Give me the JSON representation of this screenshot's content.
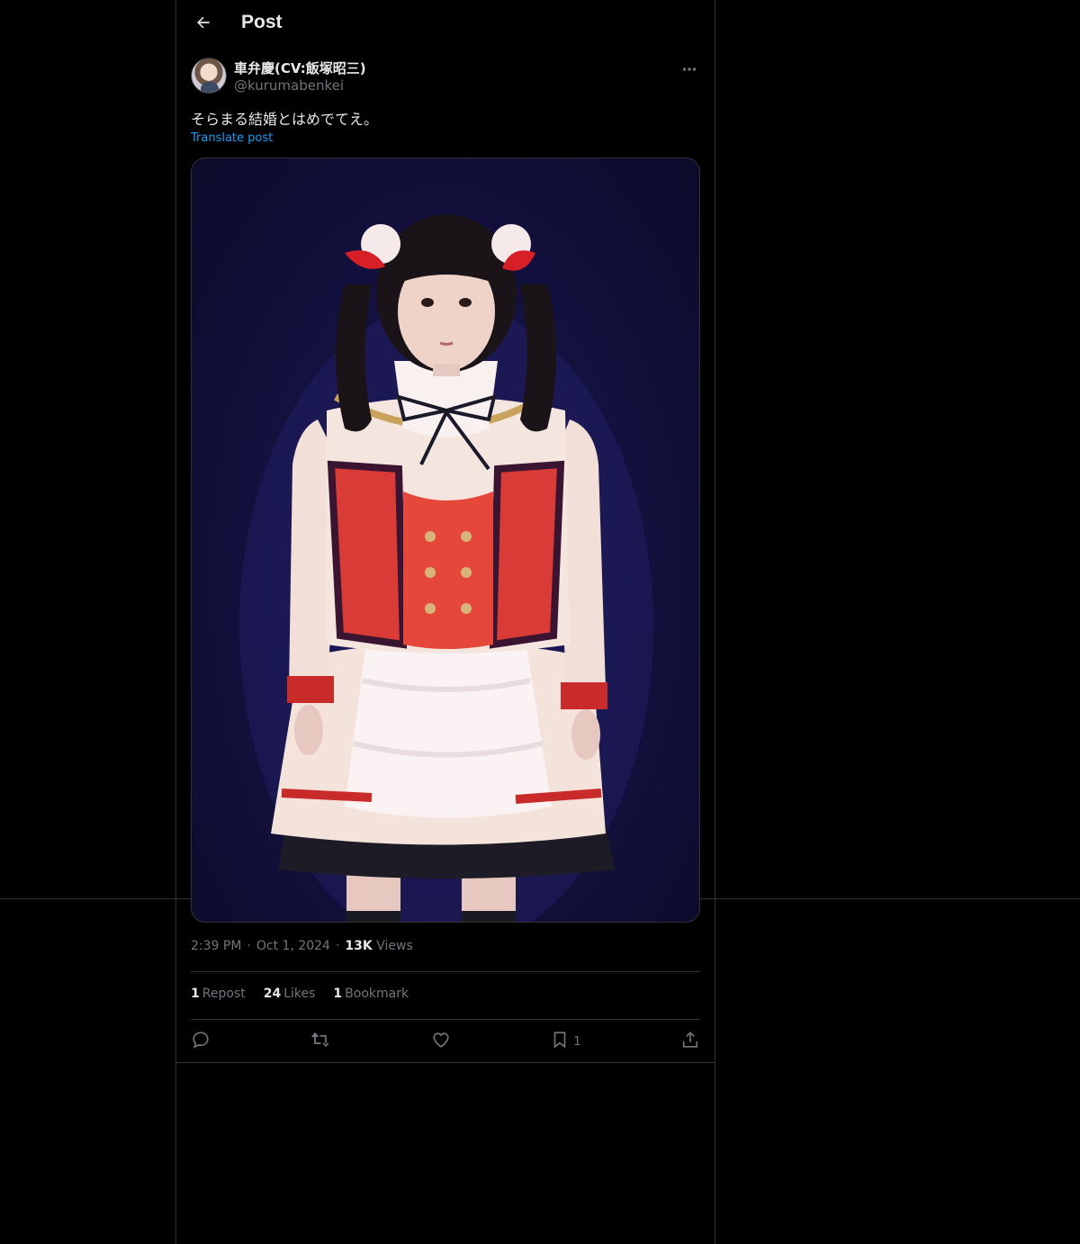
{
  "header": {
    "title": "Post"
  },
  "author": {
    "display_name": "車弁慶(CV:飯塚昭三)",
    "handle": "@kurumabenkei"
  },
  "post": {
    "text": "そらまる結婚とはめでてえ。",
    "translate_label": "Translate post",
    "time": "2:39 PM",
    "date": "Oct 1, 2024",
    "views_count": "13K",
    "views_label": "Views"
  },
  "stats": {
    "reposts_count": "1",
    "reposts_label": "Repost",
    "likes_count": "24",
    "likes_label": "Likes",
    "bookmarks_count": "1",
    "bookmarks_label": "Bookmark"
  },
  "actions": {
    "bookmark_count": "1"
  },
  "icons": [
    "back-arrow-icon",
    "more-icon",
    "reply-icon",
    "repost-icon",
    "like-icon",
    "bookmark-icon",
    "share-icon"
  ],
  "colors": {
    "background": "#000000",
    "text": "#e7e9ea",
    "secondary": "#71767b",
    "accent": "#1d9bf0",
    "border": "#2f3336"
  }
}
